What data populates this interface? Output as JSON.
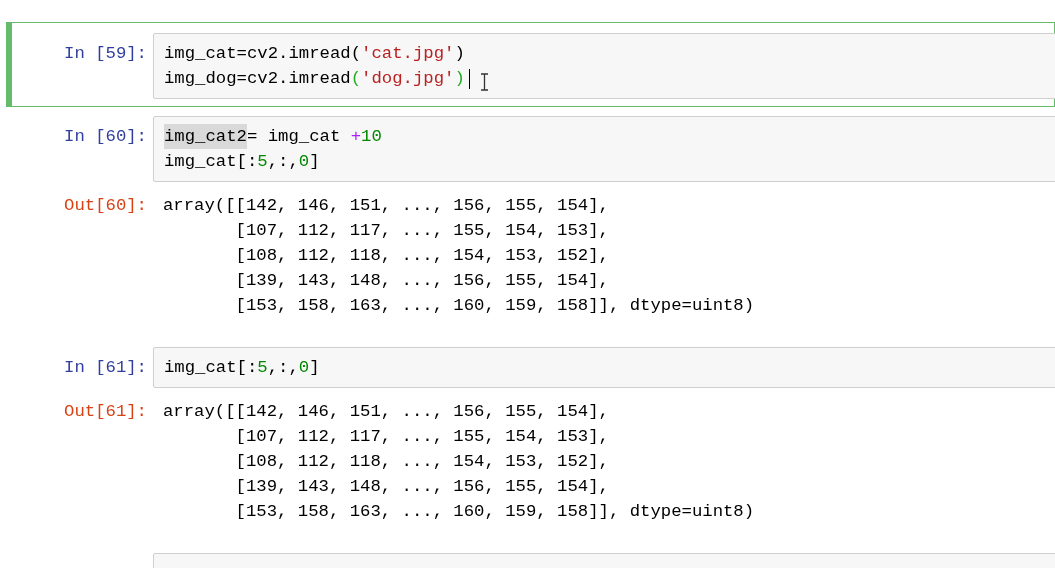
{
  "cells": [
    {
      "selected": true,
      "prompt": "In [59]:",
      "code": [
        [
          {
            "kind": "plain",
            "text": "img_cat=cv2.imread"
          },
          {
            "kind": "plain",
            "text": "("
          },
          {
            "kind": "string",
            "text": "'cat.jpg'"
          },
          {
            "kind": "plain",
            "text": ")"
          }
        ],
        [
          {
            "kind": "plain",
            "text": "img_dog=cv2.imread"
          },
          {
            "kind": "match",
            "text": "("
          },
          {
            "kind": "string",
            "text": "'dog.jpg'"
          },
          {
            "kind": "match",
            "text": ")"
          },
          {
            "kind": "caret"
          }
        ]
      ]
    },
    {
      "selected": false,
      "prompt": "In [60]:",
      "code": [
        [
          {
            "kind": "highlight",
            "text": "img_cat2"
          },
          {
            "kind": "plain",
            "text": "= img_cat "
          },
          {
            "kind": "operator",
            "text": "+"
          },
          {
            "kind": "number",
            "text": "10"
          }
        ],
        [
          {
            "kind": "plain",
            "text": "img_cat[:"
          },
          {
            "kind": "number",
            "text": "5"
          },
          {
            "kind": "plain",
            "text": ",:,"
          },
          {
            "kind": "number",
            "text": "0"
          },
          {
            "kind": "plain",
            "text": "]"
          }
        ]
      ],
      "output": {
        "prompt": "Out[60]:",
        "lines": [
          "array([[142, 146, 151, ..., 156, 155, 154],",
          "       [107, 112, 117, ..., 155, 154, 153],",
          "       [108, 112, 118, ..., 154, 153, 152],",
          "       [139, 143, 148, ..., 156, 155, 154],",
          "       [153, 158, 163, ..., 160, 159, 158]], dtype=uint8)"
        ]
      }
    },
    {
      "selected": false,
      "prompt": "In [61]:",
      "code": [
        [
          {
            "kind": "plain",
            "text": "img_cat[:"
          },
          {
            "kind": "number",
            "text": "5"
          },
          {
            "kind": "plain",
            "text": ",:,"
          },
          {
            "kind": "number",
            "text": "0"
          },
          {
            "kind": "plain",
            "text": "]"
          }
        ]
      ],
      "output": {
        "prompt": "Out[61]:",
        "lines": [
          "array([[142, 146, 151, ..., 156, 155, 154],",
          "       [107, 112, 117, ..., 155, 154, 153],",
          "       [108, 112, 118, ..., 154, 153, 152],",
          "       [139, 143, 148, ..., 156, 155, 154],",
          "       [153, 158, 163, ..., 160, 159, 158]], dtype=uint8)"
        ]
      }
    },
    {
      "selected": false
    }
  ]
}
